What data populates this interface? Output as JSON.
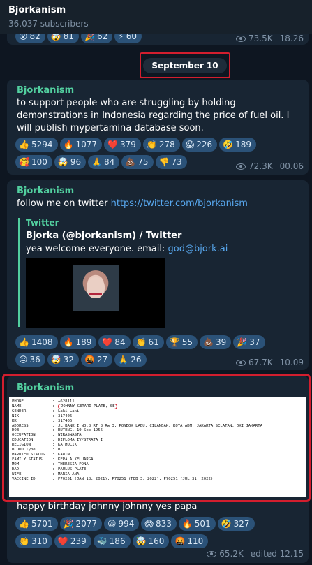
{
  "header": {
    "title": "Bjorkanism",
    "subscribers": "36,037 subscribers"
  },
  "top_partial": {
    "reactions": [
      {
        "emoji": "😮",
        "count": "82"
      },
      {
        "emoji": "🤯",
        "count": "81"
      },
      {
        "emoji": "🎉",
        "count": "62"
      },
      {
        "emoji": "⚡",
        "count": "60"
      }
    ],
    "views": "73.5K",
    "time": "18.26"
  },
  "date_separator": "September 10",
  "messages": [
    {
      "channel": "Bjorkanism",
      "text": "to support people who are struggling by holding demonstrations in Indonesia regarding the price of fuel oil. I will publish mypertamina database soon.",
      "reactions": [
        {
          "emoji": "👍",
          "count": "5294"
        },
        {
          "emoji": "🔥",
          "count": "1077"
        },
        {
          "emoji": "❤️",
          "count": "379"
        },
        {
          "emoji": "👏",
          "count": "278"
        },
        {
          "emoji": "😱",
          "count": "226"
        },
        {
          "emoji": "🤣",
          "count": "189"
        },
        {
          "emoji": "🥰",
          "count": "100"
        },
        {
          "emoji": "🤯",
          "count": "96"
        },
        {
          "emoji": "🙏",
          "count": "84"
        },
        {
          "emoji": "💩",
          "count": "75"
        },
        {
          "emoji": "👎",
          "count": "73"
        }
      ],
      "views": "72.3K",
      "time": "00.06"
    },
    {
      "channel": "Bjorkanism",
      "text": "follow me on twitter ",
      "link": "https://twitter.com/bjorkanism",
      "preview": {
        "site": "Twitter",
        "title": "Bjorka (@bjorkanism) / Twitter",
        "desc": "yea welcome everyone. email: ",
        "email": "god@bjork.ai"
      },
      "reactions": [
        {
          "emoji": "👍",
          "count": "1408"
        },
        {
          "emoji": "🔥",
          "count": "189"
        },
        {
          "emoji": "❤️",
          "count": "84"
        },
        {
          "emoji": "👏",
          "count": "61"
        },
        {
          "emoji": "🏆",
          "count": "55"
        },
        {
          "emoji": "💩",
          "count": "39"
        },
        {
          "emoji": "🎉",
          "count": "37"
        },
        {
          "emoji": "😐",
          "count": "36"
        },
        {
          "emoji": "🤯",
          "count": "32"
        },
        {
          "emoji": "🤬",
          "count": "27"
        },
        {
          "emoji": "🙏",
          "count": "26"
        }
      ],
      "views": "67.7K",
      "time": "10.09"
    },
    {
      "channel": "Bjorkanism",
      "document": [
        {
          "k": "PHONE",
          "v": "+628111"
        },
        {
          "k": "NAME",
          "v": "JOHNNY GERARD PLATE, SE"
        },
        {
          "k": "GENDER",
          "v": "Laki-Laki"
        },
        {
          "k": "NIK",
          "v": "317406"
        },
        {
          "k": "KK",
          "v": "317406"
        },
        {
          "k": "ADDRESS",
          "v": "JL.BANK  I  NO.8 RT 8 Rw 3, PONDOK LABU, CILANDAK, KOTA ADM. JAKARTA SELATAN, DKI JAKARTA"
        },
        {
          "k": "DOB",
          "v": "RUTENG, 10 Sep 1956"
        },
        {
          "k": "OCCUPATION",
          "v": "WIRASWASTA"
        },
        {
          "k": "EDUCATION",
          "v": "DIPLOMA IV/STRATA I"
        },
        {
          "k": "RELIGION",
          "v": "KATHOLIK"
        },
        {
          "k": "BLOOD Type",
          "v": "B"
        },
        {
          "k": "MARRIED STATUS",
          "v": "KAWIN"
        },
        {
          "k": "FAMILY STATUS",
          "v": "KEPALA KELUARGA"
        },
        {
          "k": "MOM",
          "v": "THERESIA PONA"
        },
        {
          "k": "DAD",
          "v": "PAULUS PLATE"
        },
        {
          "k": "WIFE",
          "v": "MARIA ANA"
        },
        {
          "k": "VACCINE ID",
          "v": "P70251 (JAN 18, 2021), P70251 (FEB 3, 2022), P70251 (JUL 31, 2022)"
        }
      ],
      "text": "happy birthday johnny johnny yes papa",
      "reactions": [
        {
          "emoji": "👍",
          "count": "5701"
        },
        {
          "emoji": "🎉",
          "count": "2077"
        },
        {
          "emoji": "😁",
          "count": "994"
        },
        {
          "emoji": "😱",
          "count": "833"
        },
        {
          "emoji": "🔥",
          "count": "501"
        },
        {
          "emoji": "🤣",
          "count": "327"
        },
        {
          "emoji": "👏",
          "count": "310"
        },
        {
          "emoji": "❤️",
          "count": "239"
        },
        {
          "emoji": "🐳",
          "count": "186"
        },
        {
          "emoji": "🤯",
          "count": "160"
        },
        {
          "emoji": "🤬",
          "count": "110"
        }
      ],
      "views": "65.2K",
      "time": "edited 12.15"
    }
  ]
}
